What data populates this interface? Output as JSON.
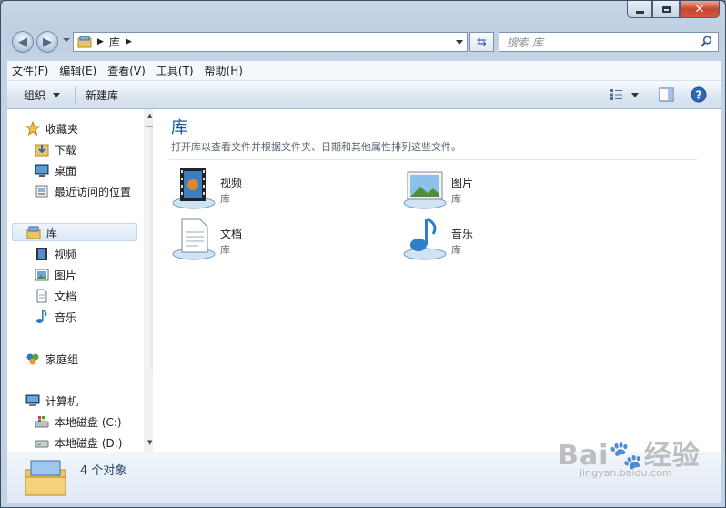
{
  "window": {
    "caption_buttons": {
      "minimize": "minimize-icon",
      "maximize": "maximize-icon",
      "close": "close-icon"
    }
  },
  "address": {
    "crumbs": [
      "库"
    ],
    "search_placeholder": "搜索 库"
  },
  "menu": [
    "文件(F)",
    "编辑(E)",
    "查看(V)",
    "工具(T)",
    "帮助(H)"
  ],
  "commands": {
    "organize": "组织",
    "new_library": "新建库"
  },
  "nav": {
    "favorites": {
      "label": "收藏夹",
      "items": [
        "下载",
        "桌面",
        "最近访问的位置"
      ]
    },
    "libraries": {
      "label": "库",
      "items": [
        "视频",
        "图片",
        "文档",
        "音乐"
      ]
    },
    "homegroup": {
      "label": "家庭组"
    },
    "computer": {
      "label": "计算机",
      "items": [
        "本地磁盘 (C:)",
        "本地磁盘 (D:)"
      ]
    }
  },
  "main": {
    "title": "库",
    "subtitle": "打开库以查看文件并根据文件夹、日期和其他属性排列这些文件。",
    "libraries": [
      {
        "name": "视频",
        "type": "库",
        "icon": "video-library-icon"
      },
      {
        "name": "图片",
        "type": "库",
        "icon": "pictures-library-icon"
      },
      {
        "name": "文档",
        "type": "库",
        "icon": "documents-library-icon"
      },
      {
        "name": "音乐",
        "type": "库",
        "icon": "music-library-icon"
      }
    ]
  },
  "details": {
    "count": "4 个对象"
  },
  "watermark": {
    "main": "Bai",
    "mid": "经验",
    "site": "jingyan.baidu.com"
  }
}
